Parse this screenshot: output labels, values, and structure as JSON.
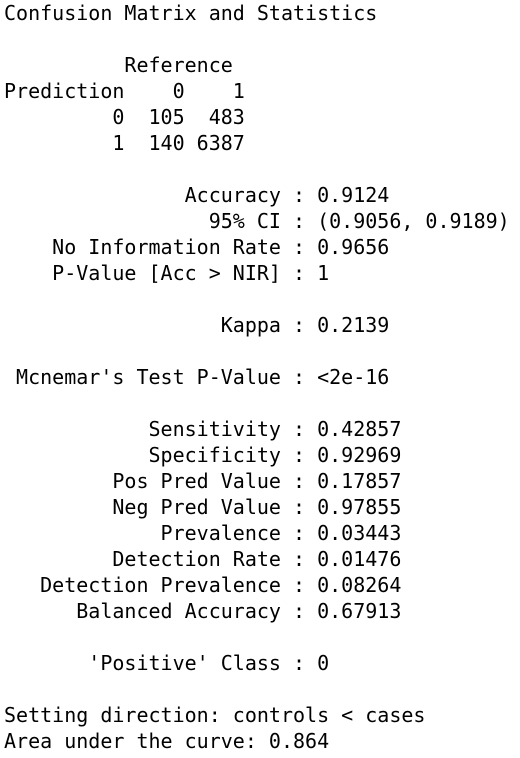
{
  "output": {
    "title": "Confusion Matrix and Statistics",
    "matrix": {
      "reference_header": "          Reference",
      "prediction_header": "Prediction    0    1",
      "row_0": "         0  105  483",
      "row_1": "         1  140 6387"
    },
    "stats": {
      "accuracy": "               Accuracy : 0.9124",
      "ci": "                 95% CI : (0.9056, 0.9189)",
      "nir": "    No Information Rate : 0.9656",
      "pvalue_acc": "    P-Value [Acc > NIR] : 1",
      "kappa": "                  Kappa : 0.2139",
      "mcnemar": " Mcnemar's Test P-Value : <2e-16",
      "sensitivity": "            Sensitivity : 0.42857",
      "specificity": "            Specificity : 0.92969",
      "ppv": "         Pos Pred Value : 0.17857",
      "npv": "         Neg Pred Value : 0.97855",
      "prevalence": "             Prevalence : 0.03443",
      "detection_rate": "         Detection Rate : 0.01476",
      "detection_prevalence": "   Detection Prevalence : 0.08264",
      "balanced_accuracy": "      Balanced Accuracy : 0.67913",
      "positive_class": "       'Positive' Class : 0"
    },
    "roc": {
      "direction": "Setting direction: controls < cases",
      "auc": "Area under the curve: 0.864"
    }
  }
}
